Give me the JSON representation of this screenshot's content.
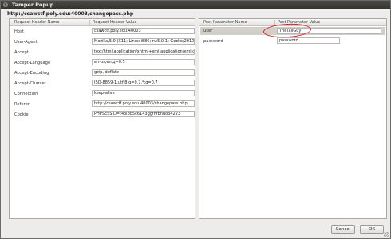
{
  "window": {
    "title": "Tamper Popup",
    "close_glyph": "×"
  },
  "url": "http://csawctf.poly.edu:40003/changepass.php",
  "request_headers": {
    "col_name": "Request Header Name",
    "col_value": "Request Header Value",
    "rows": [
      {
        "name": "Host",
        "value": "csawctf.poly.edu:40003"
      },
      {
        "name": "User-Agent",
        "value": "Mozilla/5.0 (X11; Linux i686; rv:5.0.1) Gecko/201001"
      },
      {
        "name": "Accept",
        "value": "text/html,application/xhtml+xml,application/xml;q="
      },
      {
        "name": "Accept-Language",
        "value": "en-us,en;q=0.5"
      },
      {
        "name": "Accept-Encoding",
        "value": "gzip, deflate"
      },
      {
        "name": "Accept-Charset",
        "value": "ISO-8859-1,utf-8;q=0.7,*;q=0.7"
      },
      {
        "name": "Connection",
        "value": "keep-alive"
      },
      {
        "name": "Referer",
        "value": "http://csawctf.poly.edu:40003/changepass.php"
      },
      {
        "name": "Cookie",
        "value": "PHPSESSID=t4olbq5c6143ggfhfbnuo34223"
      }
    ]
  },
  "post_params": {
    "col_name": "Post Parameter Name",
    "col_value": "Post Parameter Value",
    "rows": [
      {
        "name": "user",
        "value": "TheTallGuy",
        "selected": true
      },
      {
        "name": "password",
        "value": "password",
        "selected": false
      }
    ]
  },
  "buttons": {
    "cancel": "Cancel",
    "ok": "OK"
  },
  "annotation_color": "#e0202a"
}
